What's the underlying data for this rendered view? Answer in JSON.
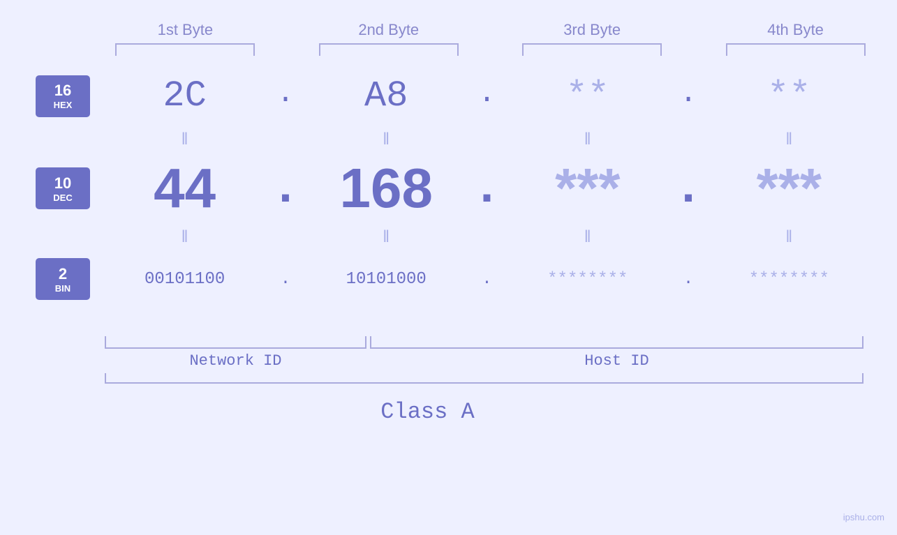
{
  "headers": {
    "byte1": "1st Byte",
    "byte2": "2nd Byte",
    "byte3": "3rd Byte",
    "byte4": "4th Byte"
  },
  "bases": {
    "hex": {
      "number": "16",
      "name": "HEX"
    },
    "dec": {
      "number": "10",
      "name": "DEC"
    },
    "bin": {
      "number": "2",
      "name": "BIN"
    }
  },
  "hex_values": {
    "b1": "2C",
    "b2": "A8",
    "b3": "**",
    "b4": "**",
    "dot": "."
  },
  "dec_values": {
    "b1": "44",
    "b2": "168",
    "b3": "***",
    "b4": "***",
    "dot": "."
  },
  "bin_values": {
    "b1": "00101100",
    "b2": "10101000",
    "b3": "********",
    "b4": "********",
    "dot": "."
  },
  "labels": {
    "network_id": "Network ID",
    "host_id": "Host ID",
    "class": "Class A"
  },
  "watermark": "ipshu.com",
  "colors": {
    "primary": "#6b6fc5",
    "light": "#aab0e8",
    "background": "#eef0ff",
    "base_bg": "#6b6fc5",
    "base_text": "#ffffff"
  }
}
